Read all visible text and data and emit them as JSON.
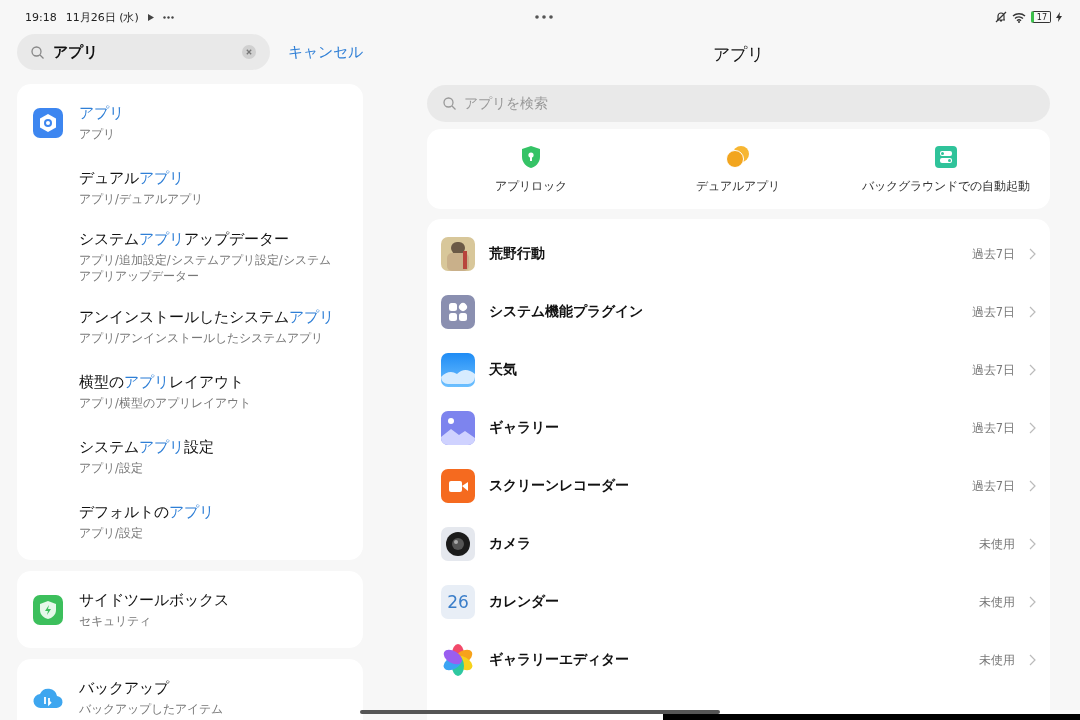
{
  "status_bar": {
    "time": "19:18",
    "date": "11月26日 (水)",
    "battery": "17"
  },
  "search": {
    "value": "アプリ",
    "cancel": "キャンセル"
  },
  "results": [
    {
      "items": [
        {
          "title": "**アプリ**",
          "path": "アプリ",
          "kind": "settings"
        },
        {
          "title": "デュアル**アプリ**",
          "path": "アプリ/デュアルアプリ",
          "kind": "none"
        },
        {
          "title": "システム**アプリ**アップデーター",
          "path": "アプリ/追加設定/システムアプリ設定/システムアプリアップデーター",
          "kind": "none"
        },
        {
          "title": "アンインストールしたシステム**アプリ**",
          "path": "アプリ/アンインストールしたシステムアプリ",
          "kind": "none"
        },
        {
          "title": "横型の**アプリ**レイアウト",
          "path": "アプリ/横型のアプリレイアウト",
          "kind": "none"
        },
        {
          "title": "システム**アプリ**設定",
          "path": "アプリ/設定",
          "kind": "none"
        },
        {
          "title": "デフォルトの**アプリ**",
          "path": "アプリ/設定",
          "kind": "none"
        }
      ]
    },
    {
      "items": [
        {
          "title": "サイドツールボックス",
          "path": "セキュリティ",
          "kind": "security"
        }
      ]
    },
    {
      "items": [
        {
          "title": "バックアップ",
          "path": "バックアップしたアイテム",
          "kind": "backup"
        }
      ]
    }
  ],
  "panel": {
    "title": "アプリ",
    "search_placeholder": "アプリを検索",
    "shortcuts": [
      {
        "label": "アプリロック",
        "kind": "lock"
      },
      {
        "label": "デュアルアプリ",
        "kind": "dual"
      },
      {
        "label": "バックグラウンドでの自動起動",
        "kind": "autostart"
      }
    ],
    "apps": [
      {
        "name": "荒野行動",
        "usage": "過去7日",
        "kind": "game"
      },
      {
        "name": "システム機能プラグイン",
        "usage": "過去7日",
        "kind": "plugin"
      },
      {
        "name": "天気",
        "usage": "過去7日",
        "kind": "weather"
      },
      {
        "name": "ギャラリー",
        "usage": "過去7日",
        "kind": "gallery"
      },
      {
        "name": "スクリーンレコーダー",
        "usage": "過去7日",
        "kind": "recorder"
      },
      {
        "name": "カメラ",
        "usage": "未使用",
        "kind": "camera"
      },
      {
        "name": "カレンダー",
        "usage": "未使用",
        "kind": "calendar",
        "icon_text": "26"
      },
      {
        "name": "ギャラリーエディター",
        "usage": "未使用",
        "kind": "editor"
      }
    ]
  }
}
